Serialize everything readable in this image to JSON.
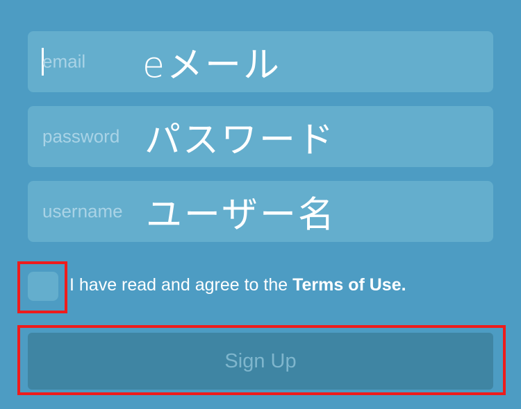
{
  "form": {
    "email": {
      "placeholder": "email",
      "annotation": "eメール"
    },
    "password": {
      "placeholder": "password",
      "annotation": "パスワード"
    },
    "username": {
      "placeholder": "username",
      "annotation": "ユーザー名"
    },
    "terms": {
      "prefix": "I have read and agree to the ",
      "link": "Terms of Use."
    },
    "signup_label": "Sign Up"
  },
  "colors": {
    "background": "#4d9cc3",
    "field": "#64aecd",
    "button": "#3f85a3",
    "highlight": "#ee1c1c"
  }
}
